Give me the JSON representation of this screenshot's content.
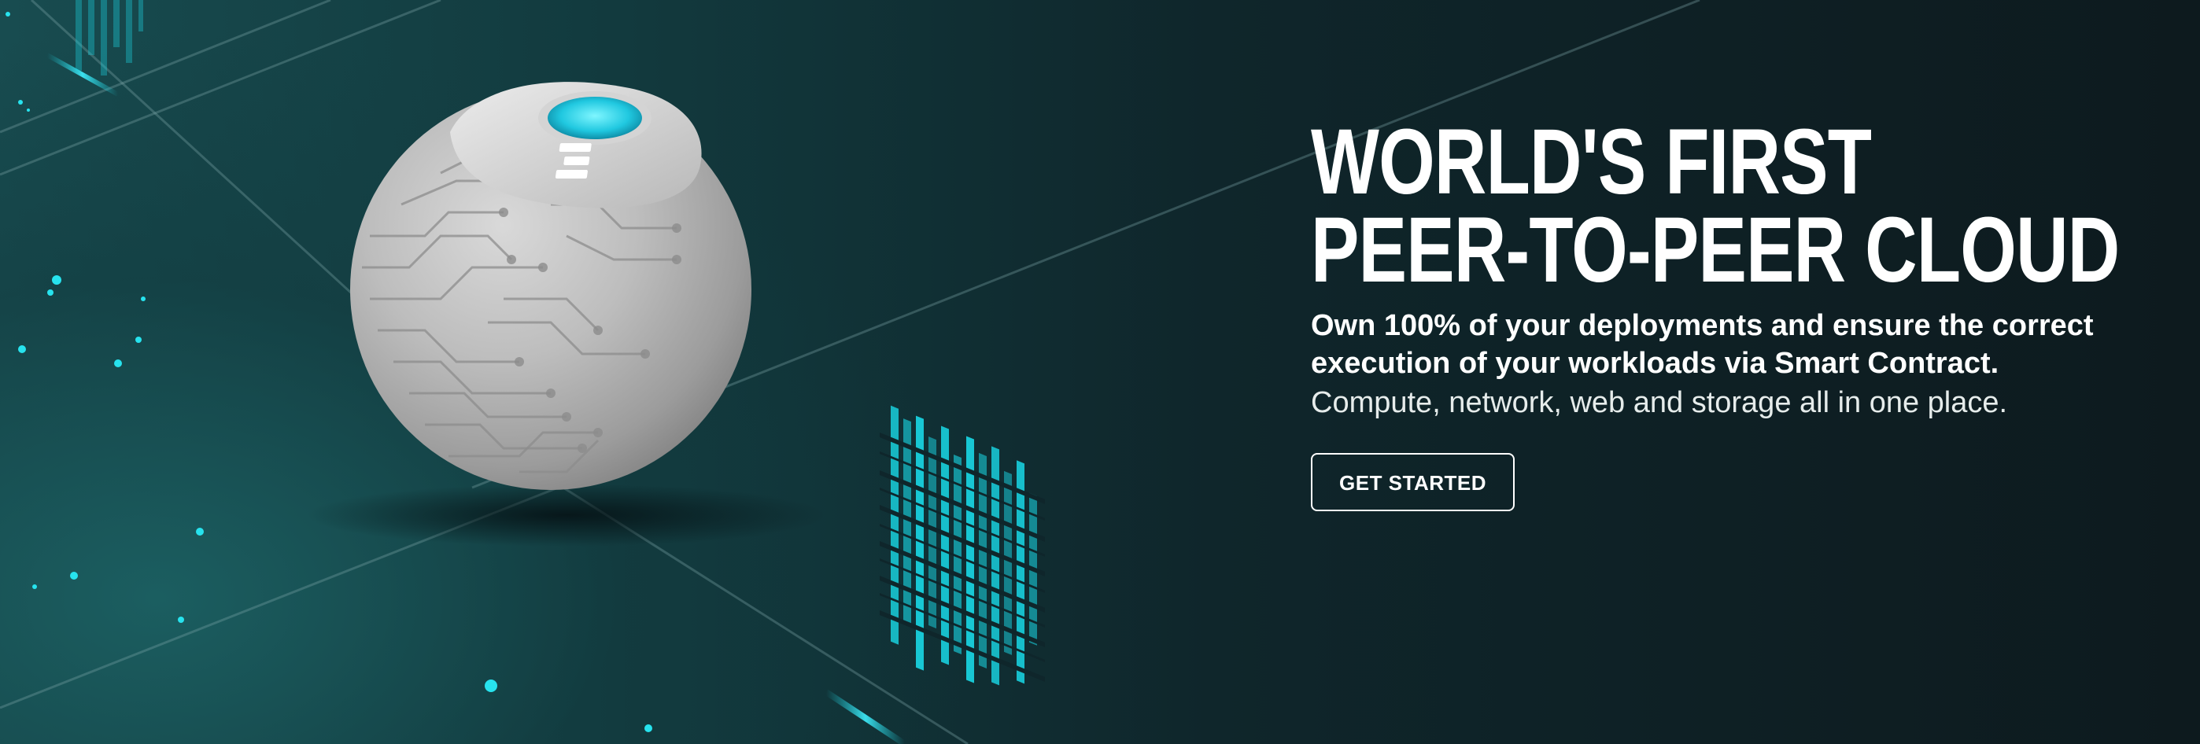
{
  "hero": {
    "headline_line1": "WORLD'S FIRST",
    "headline_line2": "PEER-TO-PEER CLOUD",
    "lead_line1": "Own 100% of your deployments and ensure the correct",
    "lead_line2": "execution of your workloads via Smart Contract.",
    "subline": "Compute, network, web and storage all in one place.",
    "cta_label": "GET STARTED"
  },
  "colors": {
    "background_dark": "#0d1b1f",
    "background_teal": "#184c50",
    "accent_cyan": "#19d8e6",
    "sphere_gray": "#b9b9b9",
    "text": "#ffffff"
  },
  "icons": {
    "logo": "stacked-bars-logo-icon"
  }
}
